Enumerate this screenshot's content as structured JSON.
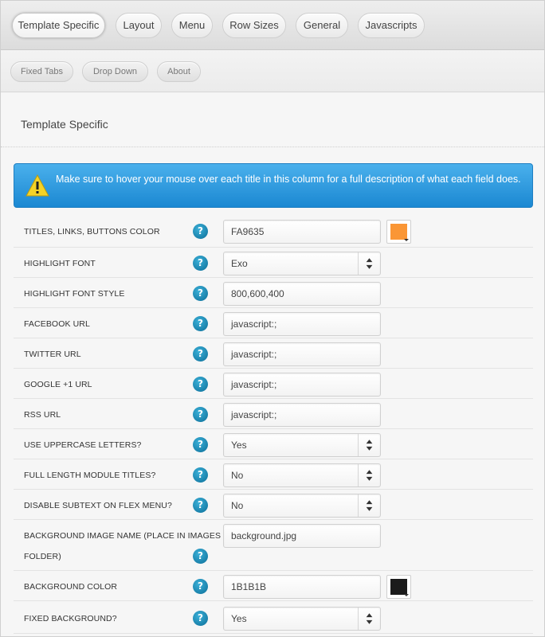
{
  "tabs": [
    "Template Specific",
    "Layout",
    "Menu",
    "Row Sizes",
    "General",
    "Javascripts"
  ],
  "subtabs": [
    "Fixed Tabs",
    "Drop Down",
    "About"
  ],
  "section_title": "Template Specific",
  "notice": "Make sure to hover your mouse over each title in this column for a full description of what each field does.",
  "rows": {
    "titles_color": {
      "label": "TITLES, LINKS, BUTTONS COLOR",
      "value": "FA9635",
      "swatch": "#FA9635"
    },
    "highlight_font": {
      "label": "HIGHLIGHT FONT",
      "value": "Exo"
    },
    "highlight_font_style": {
      "label": "HIGHLIGHT FONT STYLE",
      "value": "800,600,400"
    },
    "facebook_url": {
      "label": "FACEBOOK URL",
      "value": "javascript:;"
    },
    "twitter_url": {
      "label": "TWITTER URL",
      "value": "javascript:;"
    },
    "google_url": {
      "label": "GOOGLE +1 URL",
      "value": "javascript:;"
    },
    "rss_url": {
      "label": "RSS URL",
      "value": "javascript:;"
    },
    "uppercase": {
      "label": "USE UPPERCASE LETTERS?",
      "value": "Yes"
    },
    "full_length": {
      "label": "FULL LENGTH MODULE TITLES?",
      "value": "No"
    },
    "disable_subtext": {
      "label": "DISABLE SUBTEXT ON FLEX MENU?",
      "value": "No"
    },
    "bg_image": {
      "label_line1": "BACKGROUND IMAGE NAME (PLACE IN IMAGES",
      "label_line2": "FOLDER)",
      "value": "background.jpg"
    },
    "bg_color": {
      "label": "BACKGROUND COLOR",
      "value": "1B1B1B",
      "swatch": "#1B1B1B"
    },
    "fixed_bg": {
      "label": "FIXED BACKGROUND?",
      "value": "Yes"
    }
  },
  "help_glyph": "?",
  "icons": {
    "notice": "warning-icon",
    "help": "question-icon",
    "select": "up-down-arrows-icon"
  }
}
